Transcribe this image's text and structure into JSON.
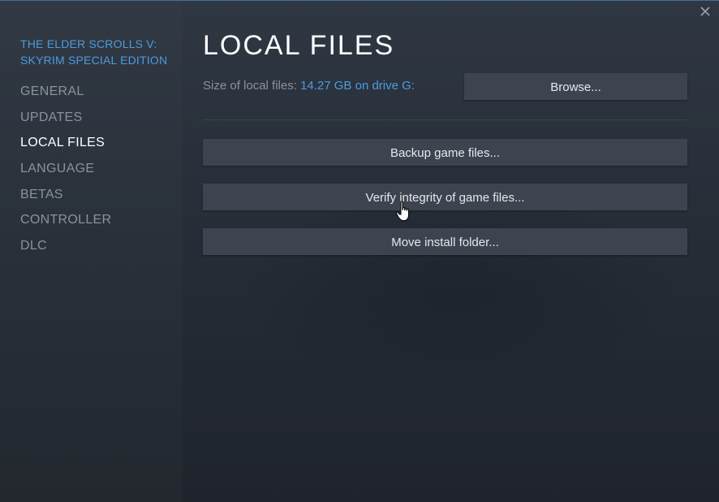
{
  "game": {
    "title_line1": "THE ELDER SCROLLS V:",
    "title_line2": "SKYRIM SPECIAL EDITION"
  },
  "sidebar": {
    "items": [
      {
        "label": "GENERAL",
        "active": false
      },
      {
        "label": "UPDATES",
        "active": false
      },
      {
        "label": "LOCAL FILES",
        "active": true
      },
      {
        "label": "LANGUAGE",
        "active": false
      },
      {
        "label": "BETAS",
        "active": false
      },
      {
        "label": "CONTROLLER",
        "active": false
      },
      {
        "label": "DLC",
        "active": false
      }
    ]
  },
  "main": {
    "title": "LOCAL FILES",
    "size_label": "Size of local files:",
    "size_value": "14.27 GB on drive G:",
    "browse_label": "Browse...",
    "backup_label": "Backup game files...",
    "verify_label": "Verify integrity of game files...",
    "move_label": "Move install folder..."
  },
  "colors": {
    "accent": "#4c9ce0",
    "button_bg": "#3d4450",
    "text_muted": "#8b929b",
    "text_active": "#ffffff"
  },
  "icons": {
    "close": "close-icon",
    "cursor": "hand-pointer-icon"
  }
}
